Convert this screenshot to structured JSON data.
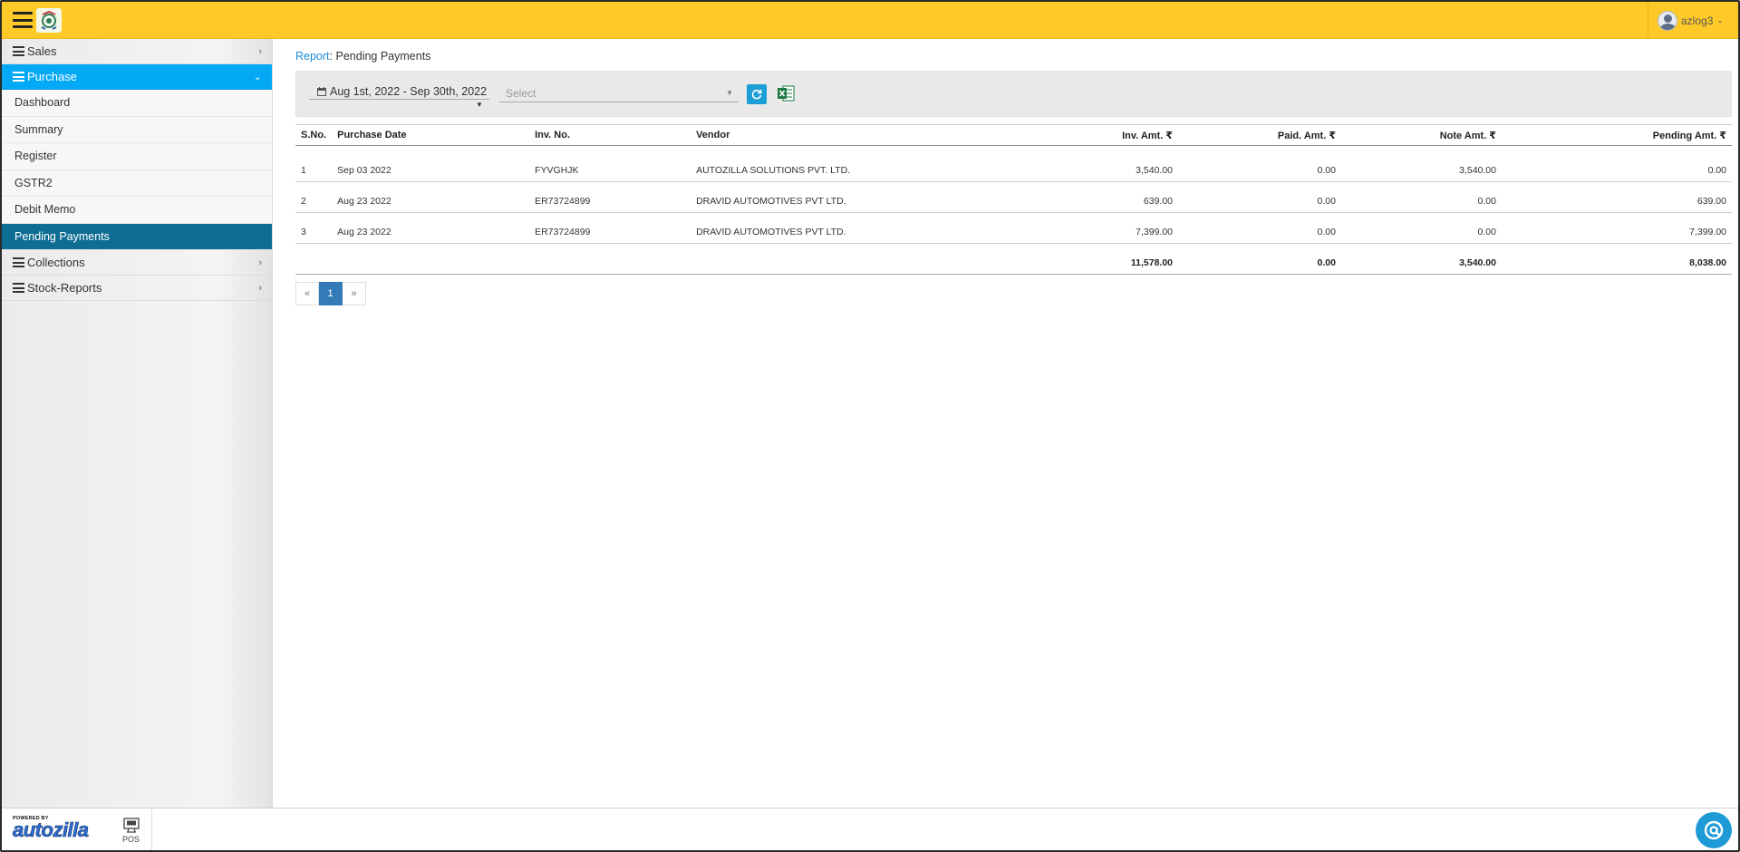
{
  "header": {
    "user_name": "azlog3",
    "icons": {
      "menu": "hamburger-icon",
      "logo": "app-logo-icon",
      "user": "user-avatar-icon",
      "caret": "chevron-down-icon"
    }
  },
  "sidebar": {
    "groups": [
      {
        "label": "Sales",
        "expanded": false
      },
      {
        "label": "Purchase",
        "expanded": true
      },
      {
        "label": "Collections",
        "expanded": false
      },
      {
        "label": "Stock-Reports",
        "expanded": false
      }
    ],
    "purchase_items": [
      "Dashboard",
      "Summary",
      "Register",
      "GSTR2",
      "Debit Memo",
      "Pending Payments"
    ],
    "active_item": "Pending Payments",
    "active_color": "#03a9f4",
    "current_color": "#0e6d93"
  },
  "breadcrumb": {
    "link": "Report",
    "separator": ":",
    "page": "Pending Payments"
  },
  "filters": {
    "date_range": "Aug 1st, 2022 - Sep 30th, 2022",
    "select_placeholder": "Select"
  },
  "table": {
    "columns": [
      "S.No.",
      "Purchase Date",
      "Inv. No.",
      "Vendor",
      "Inv. Amt. ₹",
      "Paid. Amt. ₹",
      "Note Amt. ₹",
      "Pending Amt. ₹"
    ],
    "rows": [
      {
        "sno": "1",
        "date": "Sep 03 2022",
        "inv_no": "FYVGHJK",
        "vendor": "AUTOZILLA SOLUTIONS PVT. LTD.",
        "inv_amt": "3,540.00",
        "paid_amt": "0.00",
        "note_amt": "3,540.00",
        "pending_amt": "0.00"
      },
      {
        "sno": "2",
        "date": "Aug 23 2022",
        "inv_no": "ER73724899",
        "vendor": "DRAVID AUTOMOTIVES PVT LTD.",
        "inv_amt": "639.00",
        "paid_amt": "0.00",
        "note_amt": "0.00",
        "pending_amt": "639.00"
      },
      {
        "sno": "3",
        "date": "Aug 23 2022",
        "inv_no": "ER73724899",
        "vendor": "DRAVID AUTOMOTIVES PVT LTD.",
        "inv_amt": "7,399.00",
        "paid_amt": "0.00",
        "note_amt": "0.00",
        "pending_amt": "7,399.00"
      }
    ],
    "totals": {
      "inv_amt": "11,578.00",
      "paid_amt": "0.00",
      "note_amt": "3,540.00",
      "pending_amt": "8,038.00"
    }
  },
  "pagination": {
    "prev": "«",
    "current": "1",
    "next": "»"
  },
  "footer": {
    "powered_by": "POWERED BY",
    "brand": "autozilla",
    "pos_label": "POS",
    "icons": {
      "pos": "pos-terminal-icon",
      "chat": "chat-support-icon"
    }
  }
}
